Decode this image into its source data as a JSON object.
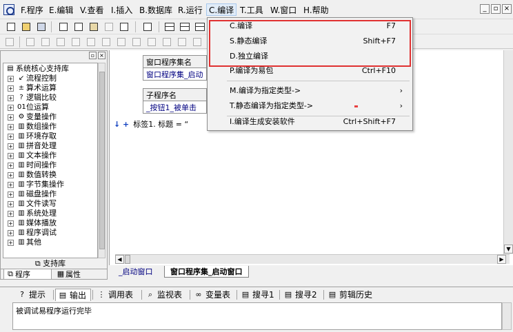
{
  "menubar": {
    "items": [
      "F.程序",
      "E.编辑",
      "V.查看",
      "I.插入",
      "B.数据库",
      "R.运行",
      "C.编译",
      "T.工具",
      "W.窗口",
      "H.帮助"
    ],
    "window_buttons": [
      "_",
      "▫",
      "×"
    ]
  },
  "compile_menu": {
    "items": [
      {
        "label": "C.编译",
        "shortcut": "F7"
      },
      {
        "label": "S.静态编译",
        "shortcut": "Shift+F7"
      },
      {
        "label": "D.独立编译",
        "shortcut": ""
      },
      {
        "label": "P.编译为易包",
        "shortcut": "Ctrl+F10"
      },
      {
        "label": "M.编译为指定类型->",
        "shortcut": ""
      },
      {
        "label": "T.静态编译为指定类型->",
        "shortcut": ""
      },
      {
        "label": "I.编译生成安装软件",
        "shortcut": "Ctrl+Shift+F7"
      }
    ],
    "submenu_arrow": "›",
    "highlight_color": "#e03030"
  },
  "left_panel": {
    "header_buttons": [
      "▫",
      "×"
    ],
    "tree": [
      {
        "label": "系统核心支持库",
        "icon": "▤",
        "expander": ""
      },
      {
        "label": "流程控制",
        "icon": "↙",
        "expander": "+"
      },
      {
        "label": "算术运算",
        "icon": "±",
        "expander": "+"
      },
      {
        "label": "逻辑比较",
        "icon": "?",
        "expander": "+"
      },
      {
        "label": "位运算",
        "icon": "01",
        "expander": "+"
      },
      {
        "label": "变量操作",
        "icon": "⚙",
        "expander": "+"
      },
      {
        "label": "数组操作",
        "icon": "▥",
        "expander": "+"
      },
      {
        "label": "环境存取",
        "icon": "▥",
        "expander": "+"
      },
      {
        "label": "拼音处理",
        "icon": "▥",
        "expander": "+"
      },
      {
        "label": "文本操作",
        "icon": "▥",
        "expander": "+"
      },
      {
        "label": "时间操作",
        "icon": "▥",
        "expander": "+"
      },
      {
        "label": "数值转换",
        "icon": "▥",
        "expander": "+"
      },
      {
        "label": "字节集操作",
        "icon": "▥",
        "expander": "+"
      },
      {
        "label": "磁盘操作",
        "icon": "▥",
        "expander": "+"
      },
      {
        "label": "文件读写",
        "icon": "▥",
        "expander": "+"
      },
      {
        "label": "系统处理",
        "icon": "▥",
        "expander": "+"
      },
      {
        "label": "媒体播放",
        "icon": "▥",
        "expander": "+"
      },
      {
        "label": "程序调试",
        "icon": "▥",
        "expander": "+"
      },
      {
        "label": "其他",
        "icon": "▥",
        "expander": "+"
      }
    ],
    "support_lib_label": "支持库",
    "tabs": [
      "程序",
      "属性"
    ]
  },
  "editor": {
    "table1_header": "窗口程序集名",
    "table1_value": "窗口程序集_启动",
    "table2_header": "子程序名",
    "table2_value": "_按钮1_被单击",
    "code_prefix": "↓ +",
    "code_text": "标签1. 标题 = “",
    "tabs": [
      "_启动窗口",
      "窗口程序集_启动窗口"
    ]
  },
  "bottom": {
    "tabs": [
      {
        "label": "提示",
        "icon": "?"
      },
      {
        "label": "输出",
        "icon": "▤"
      },
      {
        "label": "调用表",
        "icon": "⋮"
      },
      {
        "label": "监视表",
        "icon": "⌕"
      },
      {
        "label": "变量表",
        "icon": "∞"
      },
      {
        "label": "搜寻1",
        "icon": "▤"
      },
      {
        "label": "搜寻2",
        "icon": "▤"
      },
      {
        "label": "剪辑历史",
        "icon": "▤"
      }
    ],
    "output_text": "被调试易程序运行完毕"
  }
}
